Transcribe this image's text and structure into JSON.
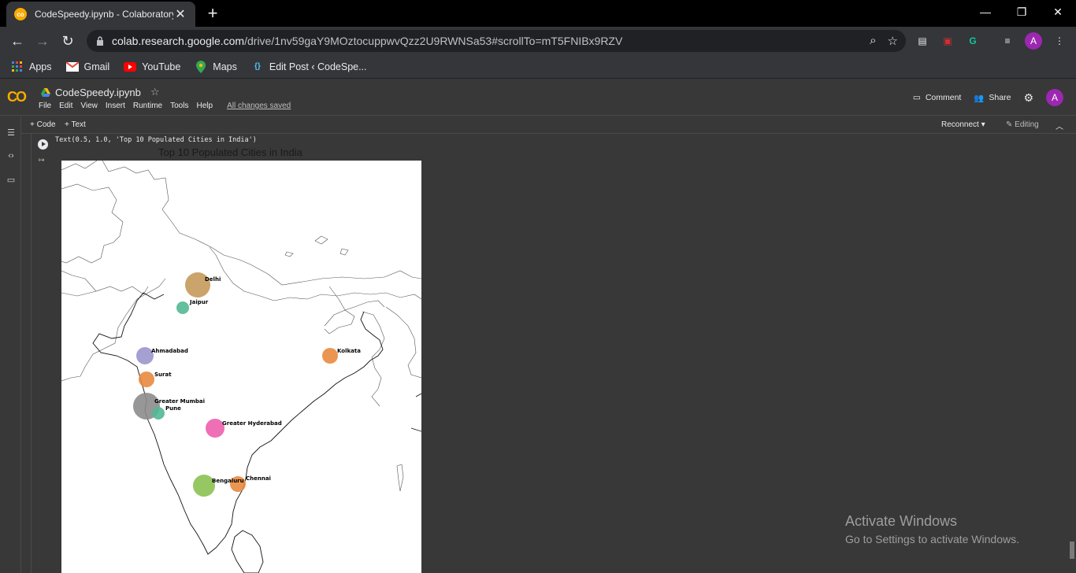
{
  "browser": {
    "tab_title": "CodeSpeedy.ipynb - Colaboratory",
    "url_host": "colab.research.google.com",
    "url_path": "/drive/1nv59gaY9MOztocuppwvQzz2U9RWNSa53#scrollTo=mT5FNIBx9RZV",
    "profile_initial": "A"
  },
  "bookmarks": [
    {
      "label": "Apps",
      "icon": "apps-grid-icon"
    },
    {
      "label": "Gmail",
      "icon": "gmail-icon"
    },
    {
      "label": "YouTube",
      "icon": "youtube-icon"
    },
    {
      "label": "Maps",
      "icon": "maps-pin-icon"
    },
    {
      "label": "Edit Post ‹ CodeSpe...",
      "icon": "braces-icon"
    }
  ],
  "colab": {
    "notebook_name": "CodeSpeedy.ipynb",
    "menu": [
      "File",
      "Edit",
      "View",
      "Insert",
      "Runtime",
      "Tools",
      "Help"
    ],
    "save_status": "All changes saved",
    "comment_label": "Comment",
    "share_label": "Share",
    "user_initial": "A",
    "add_code_label": "Code",
    "add_text_label": "Text",
    "reconnect_label": "Reconnect",
    "editing_label": "Editing"
  },
  "cell": {
    "output_repr": "Text(0.5, 1.0, 'Top 10 Populated Cities in India')"
  },
  "chart_data": {
    "type": "scatter",
    "title": "Top 10 Populated Cities in India",
    "xlabel": "",
    "ylabel": "",
    "grid": false,
    "points": [
      {
        "name": "Delhi",
        "color": "#c49a5a"
      },
      {
        "name": "Jaipur",
        "color": "#52b894"
      },
      {
        "name": "Ahmadabad",
        "color": "#9a96cc"
      },
      {
        "name": "Surat",
        "color": "#e8893e"
      },
      {
        "name": "Greater Mumbai",
        "color": "#8c8c8c"
      },
      {
        "name": "Pune",
        "color": "#52b894"
      },
      {
        "name": "Greater Hyderabad",
        "color": "#ec5fae"
      },
      {
        "name": "Bengaluru",
        "color": "#8cc152"
      },
      {
        "name": "Chennai",
        "color": "#e8893e"
      },
      {
        "name": "Kolkata",
        "color": "#e8893e"
      }
    ]
  },
  "watermark": {
    "line1": "Activate Windows",
    "line2": "Go to Settings to activate Windows."
  }
}
